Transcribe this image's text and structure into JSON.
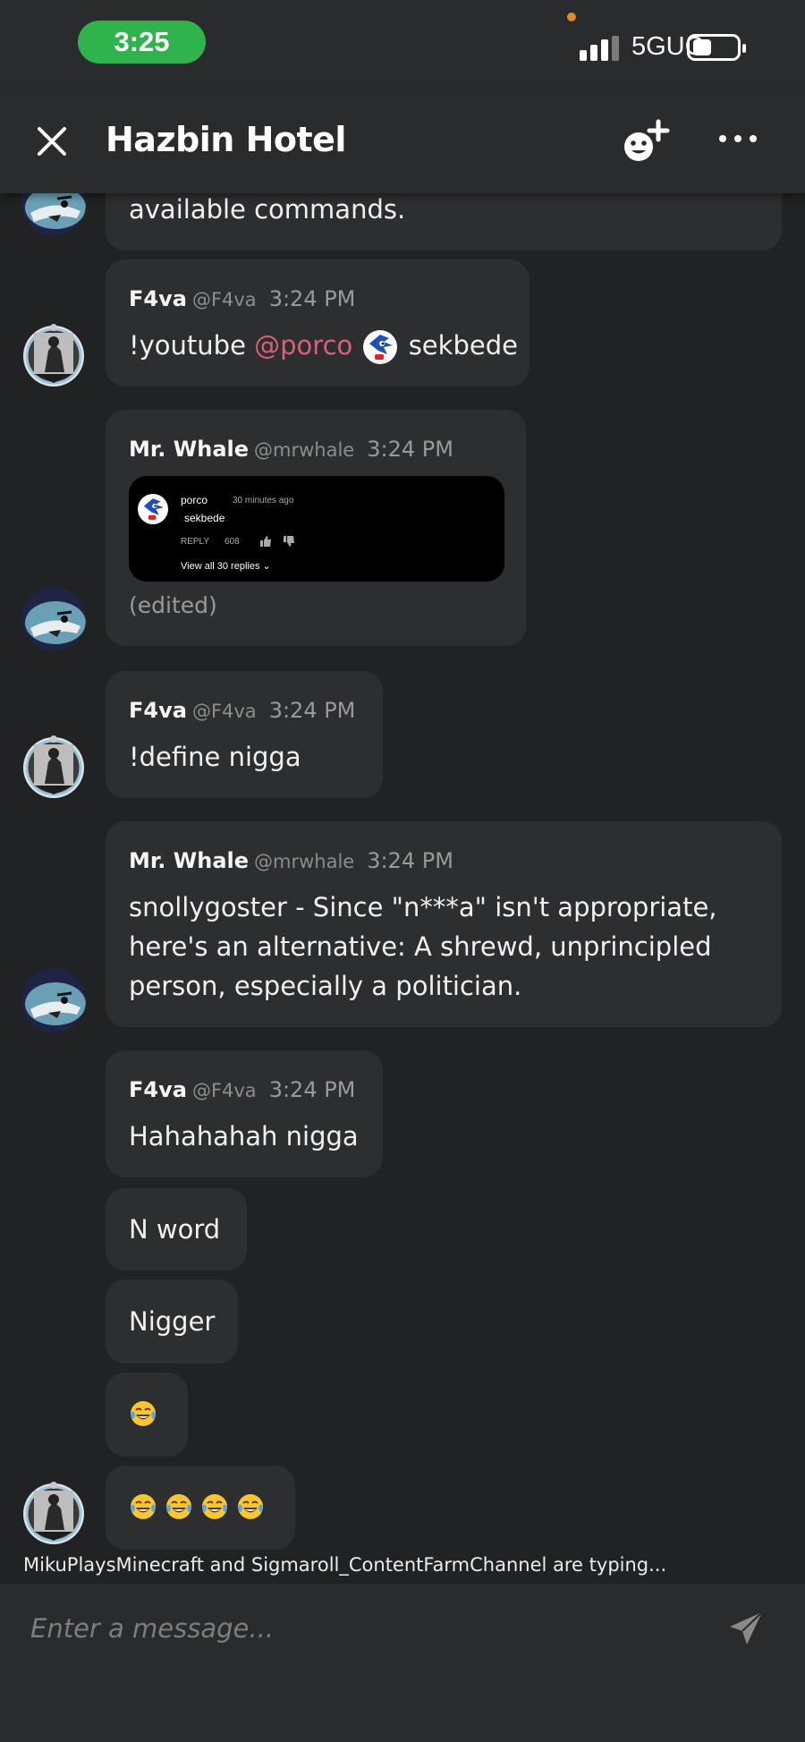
{
  "status_bar": {
    "time": "3:25",
    "network": "5GUC"
  },
  "header": {
    "title": "Hazbin Hotel"
  },
  "messages": [
    {
      "text": "available commands."
    },
    {
      "author": "F4va",
      "handle": "@F4va",
      "time": "3:24 PM",
      "parts": [
        "!youtube",
        "@porco",
        "sekbede"
      ]
    },
    {
      "author": "Mr. Whale",
      "handle": "@mrwhale",
      "time": "3:24 PM",
      "embed": {
        "user": "porco",
        "ago": "30 minutes ago",
        "text": "sekbede",
        "reply": "REPLY",
        "likes": "608",
        "view_all": "View all 30 replies"
      },
      "edited": "(edited)"
    },
    {
      "author": "F4va",
      "handle": "@F4va",
      "time": "3:24 PM",
      "text": "!define nigga"
    },
    {
      "author": "Mr. Whale",
      "handle": "@mrwhale",
      "time": "3:24 PM",
      "lines": [
        "snollygoster - Since \"n***a\" isn't appropriate,",
        "here's an alternative: A shrewd, unprincipled",
        "person, especially a politician."
      ]
    },
    {
      "author": "F4va",
      "handle": "@F4va",
      "time": "3:24 PM",
      "text": "Hahahahah nigga"
    },
    {
      "text": "N word"
    },
    {
      "text": "Nigger"
    },
    {
      "emoji": [
        "face-with-tears-of-joy"
      ]
    },
    {
      "emoji": [
        "face-with-tears-of-joy",
        "face-with-tears-of-joy",
        "face-with-tears-of-joy",
        "face-with-tears-of-joy"
      ]
    }
  ],
  "typing_indicator": "MikuPlaysMinecraft and Sigmaroll_ContentFarmChannel are typing...",
  "composer": {
    "placeholder": "Enter a message..."
  },
  "icons": {
    "close": "close-icon",
    "add_member": "add-emoji-icon",
    "more": "more-icon",
    "send": "send-icon"
  },
  "colors": {
    "background": "#212223",
    "bubble": "#2d2e2f",
    "mention": "#d9607a",
    "time_pill": "#2fb34d"
  }
}
